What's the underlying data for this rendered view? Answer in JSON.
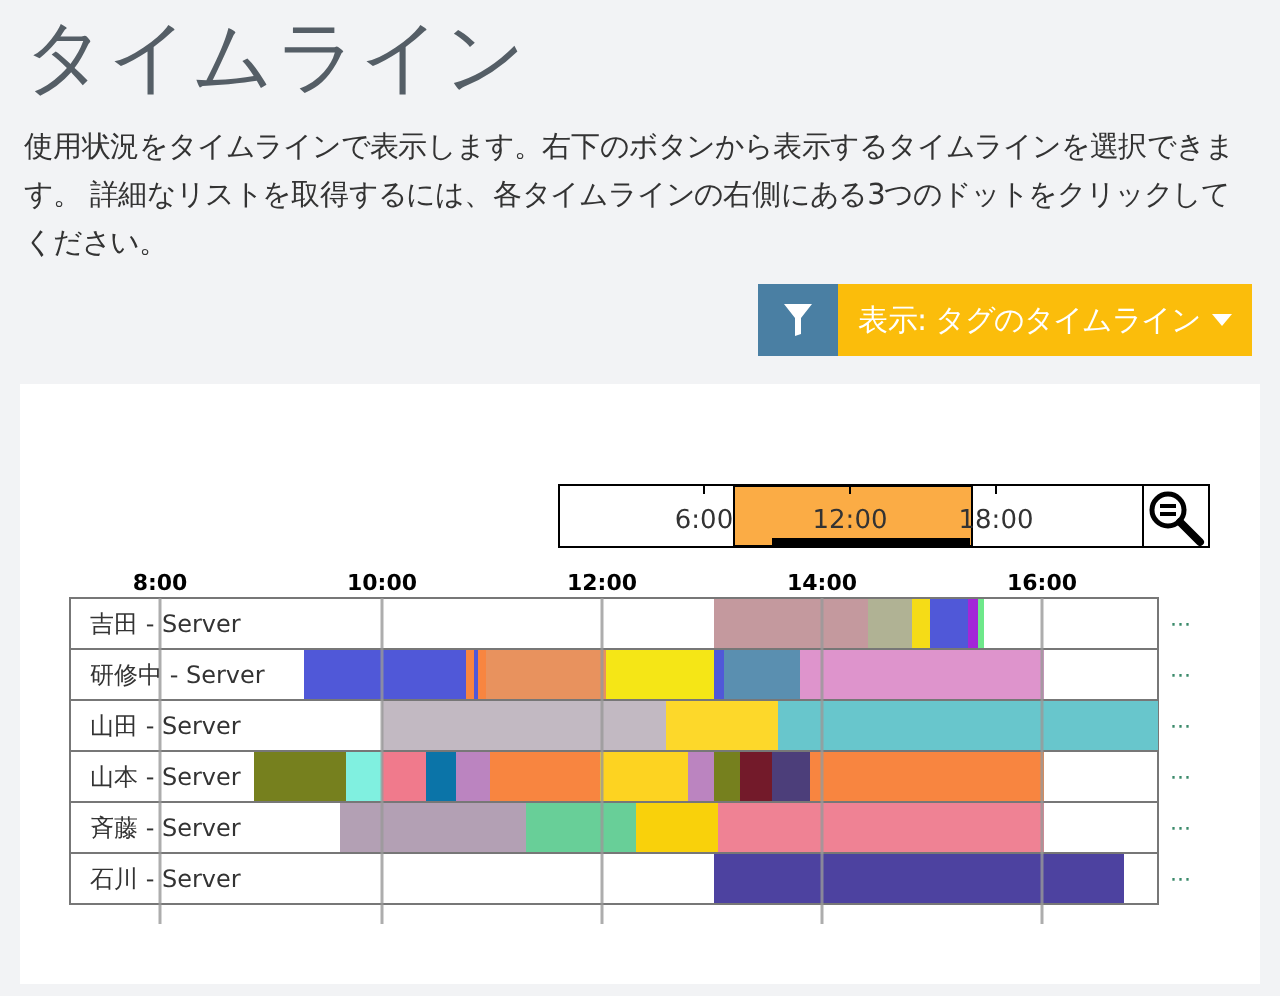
{
  "page": {
    "title": "タイムライン",
    "description": "使用状況をタイムラインで表示します。右下のボタンから表示するタイムラインを選択できます。 詳細なリストを取得するには、各タイムラインの右側にある3つのドットをクリックしてください。"
  },
  "toolbar": {
    "display_button": "表示: タグのタイムライン"
  },
  "navigator": {
    "ticks": [
      "6:00",
      "12:00",
      "18:00"
    ]
  },
  "timeline": {
    "hours": [
      "8:00",
      "10:00",
      "12:00",
      "14:00",
      "16:00"
    ],
    "rows": [
      {
        "label": "吉田 - Server",
        "more": "···"
      },
      {
        "label": "研修中 - Server",
        "more": "···"
      },
      {
        "label": "山田 - Server",
        "more": "···"
      },
      {
        "label": "山本 - Server",
        "more": "···"
      },
      {
        "label": "斉藤 - Server",
        "more": "···"
      },
      {
        "label": "石川 - Server",
        "more": "···"
      }
    ]
  }
}
